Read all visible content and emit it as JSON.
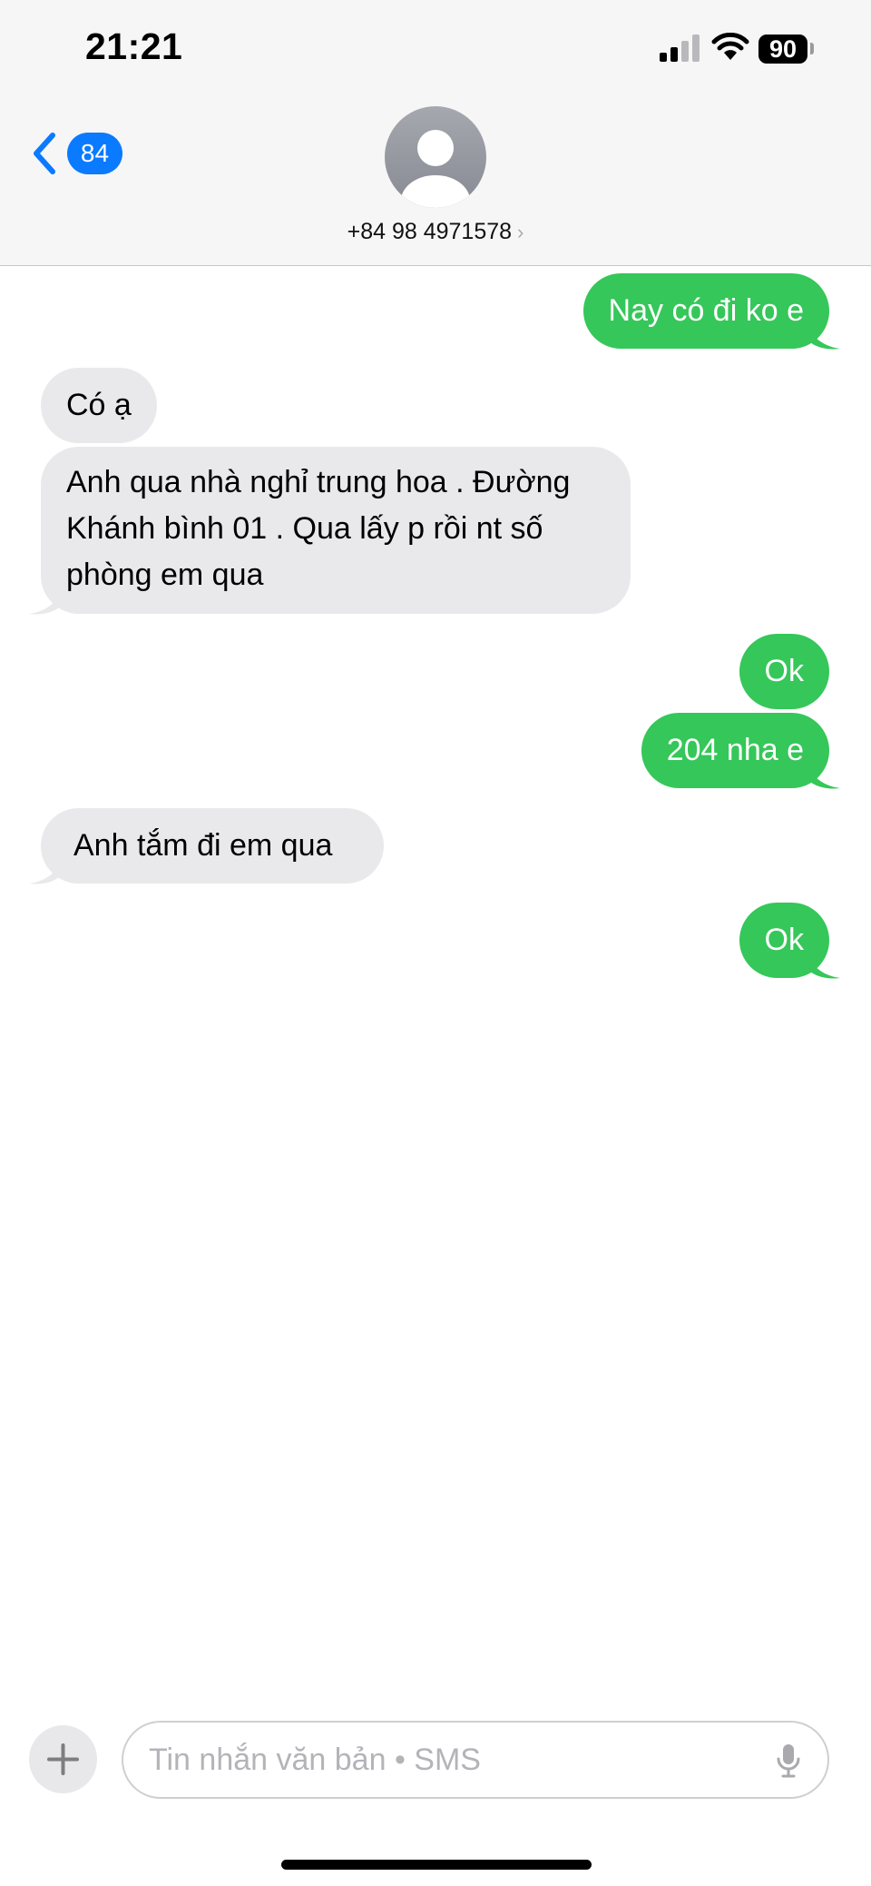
{
  "status_bar": {
    "time": "21:21",
    "battery_level": "90"
  },
  "nav": {
    "back_count": "84",
    "contact": "+84 98 4971578",
    "chevron": "›"
  },
  "messages": [
    {
      "direction": "sent",
      "text": "Nay có đi ko e"
    },
    {
      "direction": "received",
      "text": "Có ạ"
    },
    {
      "direction": "received",
      "lines": [
        "Anh qua nhà nghỉ trung hoa . Đường",
        "Khánh bình 01 . Qua lấy p rồi nt số",
        "phòng em qua"
      ]
    },
    {
      "direction": "sent",
      "text": "Ok"
    },
    {
      "direction": "sent",
      "text": "204 nha e"
    },
    {
      "direction": "received",
      "text": "Anh tắm đi em qua"
    },
    {
      "direction": "sent",
      "text": "Ok"
    }
  ],
  "composer": {
    "placeholder": "Tin nhắn văn bản • SMS"
  },
  "colors": {
    "sent": "#35c759",
    "received": "#e9e9eb",
    "accent": "#0a7aff"
  },
  "icons": [
    "signal-icon",
    "wifi-icon",
    "battery-icon",
    "back-chevron-icon",
    "avatar-icon",
    "plus-icon",
    "microphone-icon"
  ]
}
